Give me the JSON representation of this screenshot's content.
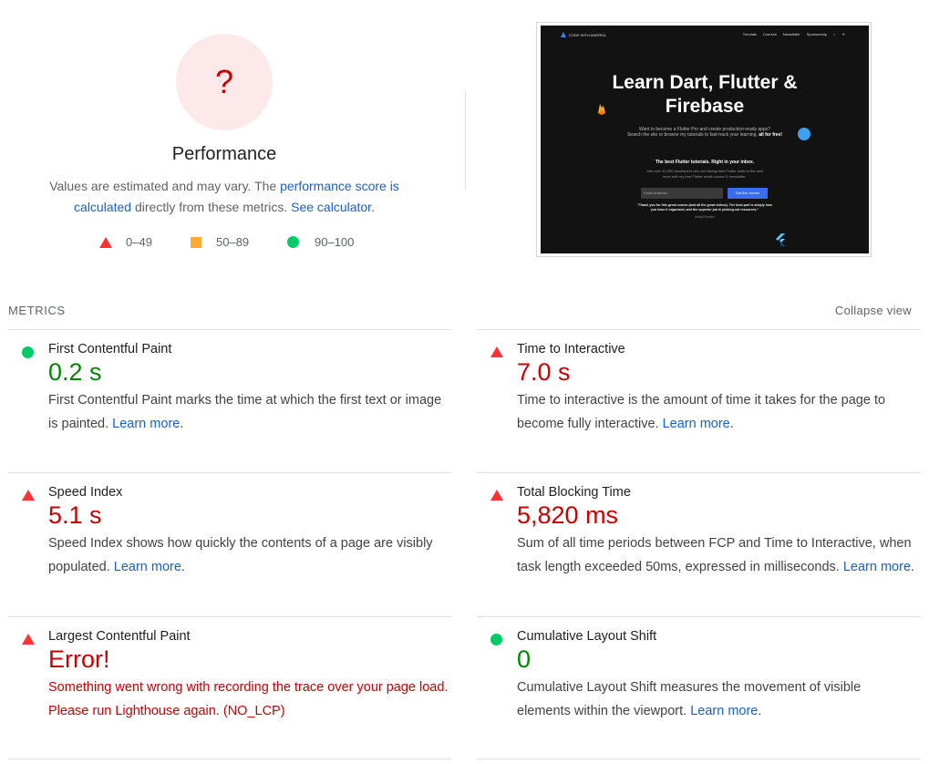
{
  "gauge": {
    "score": "?",
    "title": "Performance",
    "desc_prefix": "Values are estimated and may vary. The ",
    "desc_link": "performance score is calculated",
    "desc_mid": " directly from these metrics. ",
    "calc_link": "See calculator.",
    "legend": [
      {
        "label": "0–49",
        "color": "#ff3333",
        "shape": "triangle"
      },
      {
        "label": "50–89",
        "color": "#ffaa33",
        "shape": "square"
      },
      {
        "label": "90–100",
        "color": "#00cc66",
        "shape": "circle"
      }
    ]
  },
  "thumbnail": {
    "nav_brand": "CODE WITH ANDREA",
    "nav_links": [
      "Tutorials",
      "Courses",
      "Newsletter",
      "Sponsorship"
    ],
    "headline_1": "Learn Dart, Flutter &",
    "headline_2": "Firebase",
    "sub_1": "Want to become a Flutter Pro and create production-ready apps?",
    "sub_2": "Search the site or browse my tutorials to fast-track your learning,",
    "sub_bold": "all for free!",
    "cta_title": "The best Flutter tutorials. Right in your inbox.",
    "cta_sub_1": "Join over 10,000 developers who are taking their Flutter skills to the next",
    "cta_sub_2": "level with my free Flutter email course & newsletter.",
    "input_placeholder": "Email Address",
    "button": "Get the course",
    "quote": "\"Thank you for this great course (and all the great videos). The best part is simply how you have it organized, and the superior job in picking out resources.\"",
    "author": "Andy Rhodes"
  },
  "metrics_header": "METRICS",
  "collapse_label": "Collapse view",
  "learn_more": "Learn more",
  "metrics": {
    "fcp": {
      "title": "First Contentful Paint",
      "value": "0.2 s",
      "status": "good",
      "desc": "First Contentful Paint marks the time at which the first text or image is painted. "
    },
    "tti": {
      "title": "Time to Interactive",
      "value": "7.0 s",
      "status": "bad",
      "desc": "Time to interactive is the amount of time it takes for the page to become fully interactive. "
    },
    "si": {
      "title": "Speed Index",
      "value": "5.1 s",
      "status": "bad",
      "desc": "Speed Index shows how quickly the contents of a page are visibly populated. "
    },
    "tbt": {
      "title": "Total Blocking Time",
      "value": "5,820 ms",
      "status": "bad",
      "desc": "Sum of all time periods between FCP and Time to Interactive, when task length exceeded 50ms, expressed in milliseconds. "
    },
    "lcp": {
      "title": "Largest Contentful Paint",
      "value": "Error!",
      "status": "bad",
      "desc": "Something went wrong with recording the trace over your page load. Please run Lighthouse again. (NO_LCP)"
    },
    "cls": {
      "title": "Cumulative Layout Shift",
      "value": "0",
      "status": "good",
      "desc": "Cumulative Layout Shift measures the movement of visible elements within the viewport. "
    }
  },
  "period": "."
}
